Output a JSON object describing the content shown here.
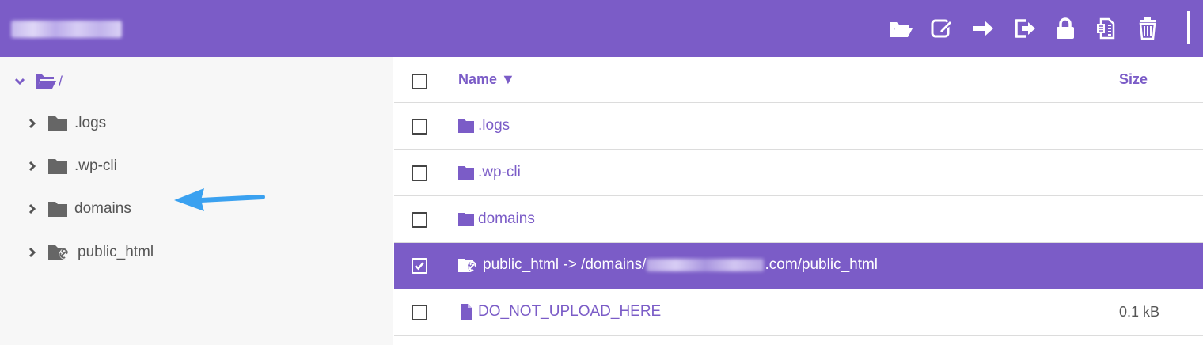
{
  "colors": {
    "accent": "#7b5cc7",
    "arrow": "#3aa1f0",
    "text": "#555555"
  },
  "toolbar": {
    "icons": [
      "folder-open-icon",
      "edit-icon",
      "move-arrow-icon",
      "export-icon",
      "lock-icon",
      "archive-icon",
      "trash-icon"
    ]
  },
  "sidebar": {
    "root_label": "/",
    "items": [
      {
        "label": ".logs",
        "icon": "folder-icon"
      },
      {
        "label": ".wp-cli",
        "icon": "folder-icon"
      },
      {
        "label": "domains",
        "icon": "folder-icon"
      },
      {
        "label": "public_html",
        "icon": "symlink-folder-icon"
      }
    ]
  },
  "table": {
    "headers": {
      "name": "Name ▼",
      "size": "Size"
    },
    "rows": [
      {
        "name": ".logs",
        "size": "",
        "type": "folder",
        "checked": false
      },
      {
        "name": ".wp-cli",
        "size": "",
        "type": "folder",
        "checked": false
      },
      {
        "name": "domains",
        "size": "",
        "type": "folder",
        "checked": false
      },
      {
        "name_prefix": "public_html -> /domains/",
        "name_suffix": ".com/public_html",
        "size": "",
        "type": "symlink",
        "checked": true
      },
      {
        "name": "DO_NOT_UPLOAD_HERE",
        "size": "0.1 kB",
        "type": "file",
        "checked": false
      }
    ]
  }
}
